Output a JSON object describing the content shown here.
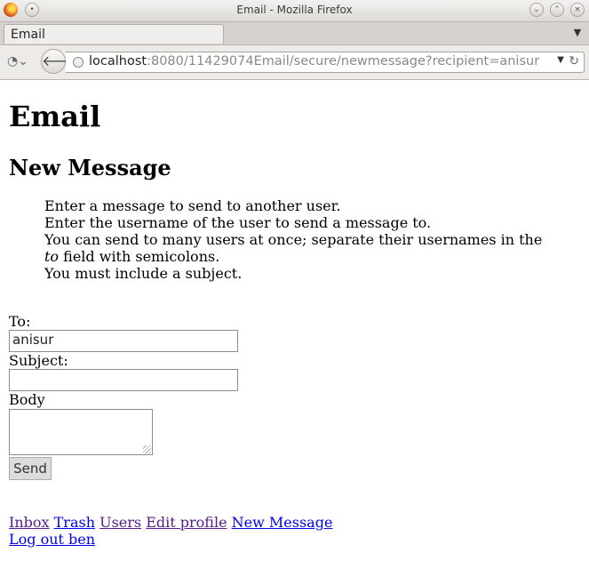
{
  "window": {
    "title": "Email - Mozilla Firefox"
  },
  "tab": {
    "label": "Email"
  },
  "address_bar": {
    "host": "localhost",
    "rest": ":8080/11429074Email/secure/newmessage?recipient=anisur"
  },
  "page": {
    "heading": "Email",
    "subheading": "New Message",
    "instructions": [
      "Enter a message to send to another user.",
      "Enter the username of the user to send a message to.",
      "You can send to many users at once; separate their usernames in the",
      "to",
      "field with semicolons.",
      "You must include a subject."
    ],
    "form": {
      "to_label": "To:",
      "to_value": "anisur",
      "subject_label": "Subject:",
      "subject_value": "",
      "body_label": "Body",
      "body_value": "",
      "send_label": "Send"
    },
    "nav_links": {
      "inbox": "Inbox",
      "trash": "Trash",
      "users": "Users",
      "edit_profile": "Edit profile",
      "new_message": "New Message",
      "logout": "Log out ben"
    }
  },
  "colors": {
    "link": "#0000ee",
    "visited_link": "#551a8b"
  }
}
